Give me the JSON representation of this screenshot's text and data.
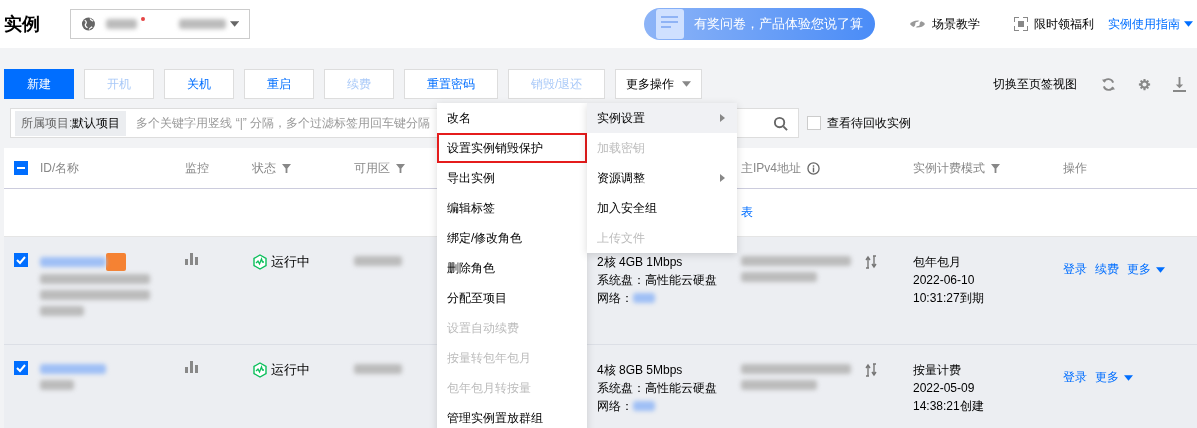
{
  "header": {
    "title": "实例",
    "survey": "有奖问卷，产品体验您说了算",
    "links": [
      {
        "label": "场景教学",
        "kind": "eye"
      },
      {
        "label": "限时领福利",
        "kind": "qr"
      },
      {
        "label": "实例使用指南",
        "kind": "guide"
      }
    ]
  },
  "toolbar": {
    "buttons": [
      {
        "label": "新建",
        "kind": "primary",
        "disabled": false
      },
      {
        "label": "开机",
        "kind": "normal",
        "disabled": true
      },
      {
        "label": "关机",
        "kind": "normal",
        "disabled": false
      },
      {
        "label": "重启",
        "kind": "normal",
        "disabled": false
      },
      {
        "label": "续费",
        "kind": "normal",
        "disabled": true
      },
      {
        "label": "重置密码",
        "kind": "normal",
        "disabled": false
      },
      {
        "label": "销毁/退还",
        "kind": "normal",
        "disabled": true
      },
      {
        "label": "更多操作",
        "kind": "dropdown",
        "disabled": false
      }
    ],
    "view_switch": "切换至页签视图"
  },
  "filter": {
    "project_label": "所属项目:",
    "project_value": "默认项目",
    "placeholder": "多个关键字用竖线 “|” 分隔，多个过滤标签用回车键分隔",
    "recycle": {
      "label": "查看待回收实例",
      "checked": false
    }
  },
  "table": {
    "select_all": {
      "indeterminate": true
    },
    "columns": [
      {
        "label": "ID/名称",
        "filter": false,
        "info": false
      },
      {
        "label": "监控",
        "filter": false,
        "info": false
      },
      {
        "label": "状态",
        "filter": true,
        "info": false
      },
      {
        "label": "可用区",
        "filter": true,
        "info": false
      },
      {
        "label": "主IPv4地址",
        "filter": false,
        "info": true
      },
      {
        "label": "实例计费模式",
        "filter": true,
        "info": false
      },
      {
        "label": "操作",
        "filter": false,
        "info": false
      }
    ],
    "notice": "表",
    "rows": [
      {
        "checked": true,
        "tag": true,
        "kind": "long-name",
        "status": "运行中",
        "config": [
          "2核 4GB 1Mbps",
          "系统盘：高性能云硬盘"
        ],
        "network_label": "网络：",
        "billing": [
          "包年包月",
          "2022-06-10",
          "10:31:27到期"
        ],
        "actions": [
          "登录",
          "续费"
        ],
        "more": "更多"
      },
      {
        "checked": true,
        "tag": false,
        "kind": "short-name",
        "status": "运行中",
        "config": [
          "4核 8GB 5Mbps",
          "系统盘：高性能云硬盘"
        ],
        "network_label": "网络：",
        "billing": [
          "按量计费",
          "2022-05-09",
          "14:38:21创建"
        ],
        "actions": [
          "登录"
        ],
        "more": "更多"
      }
    ]
  },
  "menu": {
    "items": [
      {
        "label": "改名",
        "disabled": false,
        "outlined": false
      },
      {
        "label": "设置实例销毁保护",
        "disabled": false,
        "outlined": true
      },
      {
        "label": "导出实例",
        "disabled": false,
        "outlined": false
      },
      {
        "label": "编辑标签",
        "disabled": false,
        "outlined": false
      },
      {
        "label": "绑定/修改角色",
        "disabled": false,
        "outlined": false
      },
      {
        "label": "删除角色",
        "disabled": false,
        "outlined": false
      },
      {
        "label": "分配至项目",
        "disabled": false,
        "outlined": false
      },
      {
        "label": "设置自动续费",
        "disabled": true,
        "outlined": false
      },
      {
        "label": "按量转包年包月",
        "disabled": true,
        "outlined": false
      },
      {
        "label": "包年包月转按量",
        "disabled": true,
        "outlined": false
      },
      {
        "label": "管理实例置放群组",
        "disabled": false,
        "outlined": false
      }
    ],
    "submenu": [
      {
        "label": "实例设置",
        "disabled": false,
        "selected": true,
        "has_children": true
      },
      {
        "label": "加载密钥",
        "disabled": true,
        "selected": false,
        "has_children": false
      },
      {
        "label": "资源调整",
        "disabled": false,
        "selected": false,
        "has_children": true
      },
      {
        "label": "加入安全组",
        "disabled": false,
        "selected": false,
        "has_children": false
      },
      {
        "label": "上传文件",
        "disabled": true,
        "selected": false,
        "has_children": false
      }
    ]
  }
}
